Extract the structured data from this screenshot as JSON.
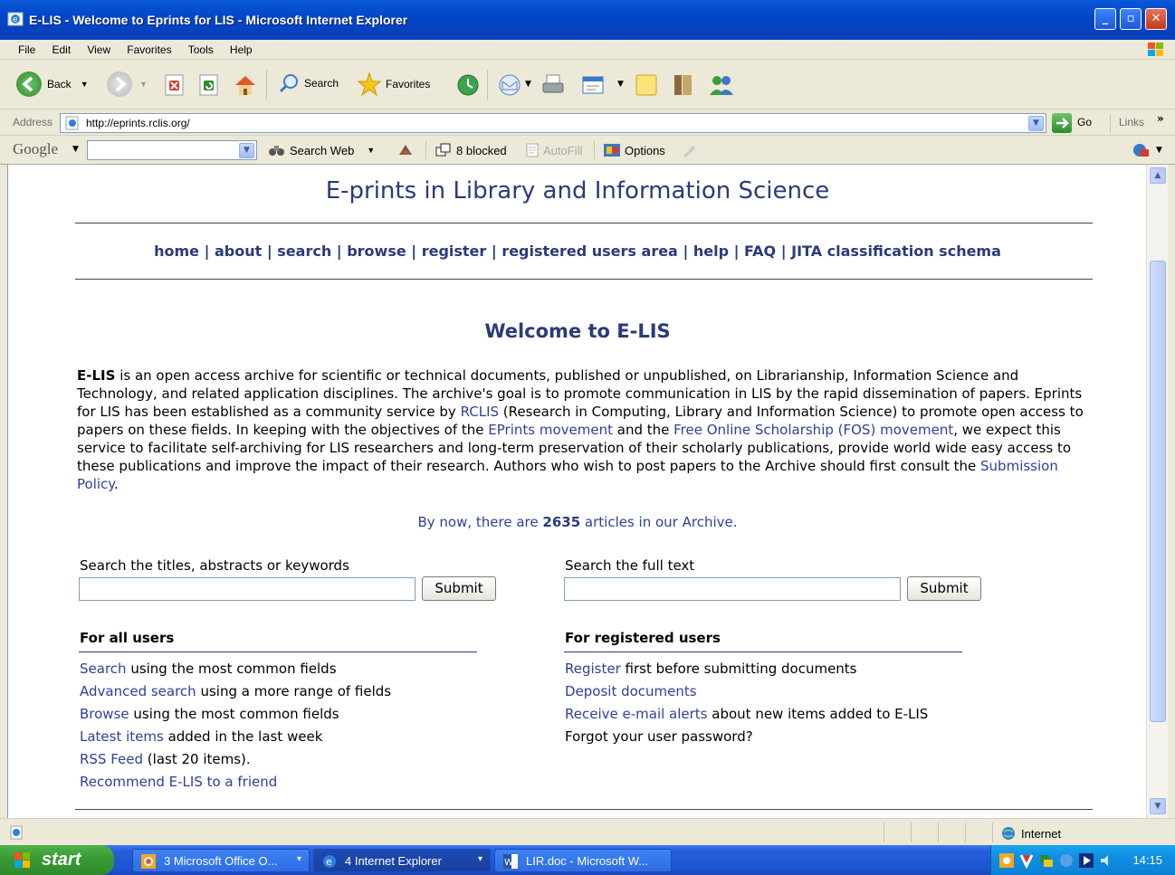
{
  "window": {
    "title": "E-LIS - Welcome to Eprints for LIS - Microsoft Internet Explorer",
    "min": "_",
    "max": "▫",
    "close": "✕"
  },
  "menu": [
    "File",
    "Edit",
    "View",
    "Favorites",
    "Tools",
    "Help"
  ],
  "toolbar": {
    "back": "Back",
    "search": "Search",
    "favorites": "Favorites"
  },
  "address": {
    "label": "Address",
    "url": "http://eprints.rclis.org/",
    "go": "Go",
    "links": "Links"
  },
  "googlebar": {
    "brand": "Google",
    "search_web": "Search Web",
    "blocked": "8 blocked",
    "autofill": "AutoFill",
    "options": "Options"
  },
  "page": {
    "site_title": "E-prints in Library and Information Science",
    "nav": [
      "home",
      "about",
      "search",
      "browse",
      "register",
      "registered users area",
      "help",
      "FAQ",
      "JITA classification schema"
    ],
    "nav_sep": "|",
    "welcome": "Welcome to E-LIS",
    "intro": {
      "elis": "E-LIS",
      "p1": " is an open access archive for scientific or technical documents, published or unpublished, on Librarianship, Information Science and Technology, and related application disciplines. The archive's goal is to promote communication in LIS by the rapid dissemination of papers. Eprints for LIS has been established as a community service by ",
      "rclis": "RCLIS",
      "p2": " (Research in Computing, Library and Information Science) to promote open access to papers on these fields. In keeping with the objectives of the ",
      "eprints_movement": "EPrints movement",
      "p3": " and the ",
      "fos_movement": "Free Online Scholarship (FOS) movement",
      "p4": ", we expect this service to facilitate self-archiving for LIS researchers and long-term preservation of their scholarly publications, provide world wide easy access to these publications and improve the impact of their research. Authors who wish to post papers to the Archive should first consult the ",
      "submission_policy": "Submission Policy",
      "p5": "."
    },
    "count": {
      "pre": "By now, there are ",
      "number": "2635",
      "post": " articles in our Archive."
    },
    "search_titles_label": "Search the titles, abstracts or keywords",
    "search_fulltext_label": "Search the full text",
    "submit": "Submit",
    "all_users": {
      "heading": "For all users",
      "items": [
        {
          "link": "Search",
          "rest": " using the most common fields"
        },
        {
          "link": "Advanced search",
          "rest": " using a more range of fields"
        },
        {
          "link": "Browse",
          "rest": " using the most common fields"
        },
        {
          "link": "Latest items",
          "rest": " added in the last week"
        },
        {
          "link": "RSS Feed",
          "rest": " (last 20 items)."
        },
        {
          "link": "Recommend E-LIS to a friend",
          "rest": ""
        }
      ]
    },
    "registered_users": {
      "heading": "For registered users",
      "items": [
        {
          "link": "Register",
          "rest": " first before submitting documents"
        },
        {
          "link": "Deposit documents",
          "rest": ""
        },
        {
          "link": "Receive e-mail alerts",
          "rest": " about new items added to E-LIS"
        },
        {
          "link": "",
          "rest": "Forgot your user password?"
        }
      ]
    }
  },
  "status": {
    "zone": "Internet"
  },
  "taskbar": {
    "start": "start",
    "tasks": [
      {
        "label": "3 Microsoft Office O...",
        "chevron": "▾"
      },
      {
        "label": "4 Internet Explorer",
        "chevron": "▾"
      },
      {
        "label": "LIR.doc - Microsoft W...",
        "chevron": ""
      }
    ],
    "clock": "14:15"
  },
  "colors": {
    "link": "#2e3f9a",
    "heading": "#2b3a7a",
    "xp_blue": "#0047c9",
    "start_green": "#3a9d36"
  }
}
